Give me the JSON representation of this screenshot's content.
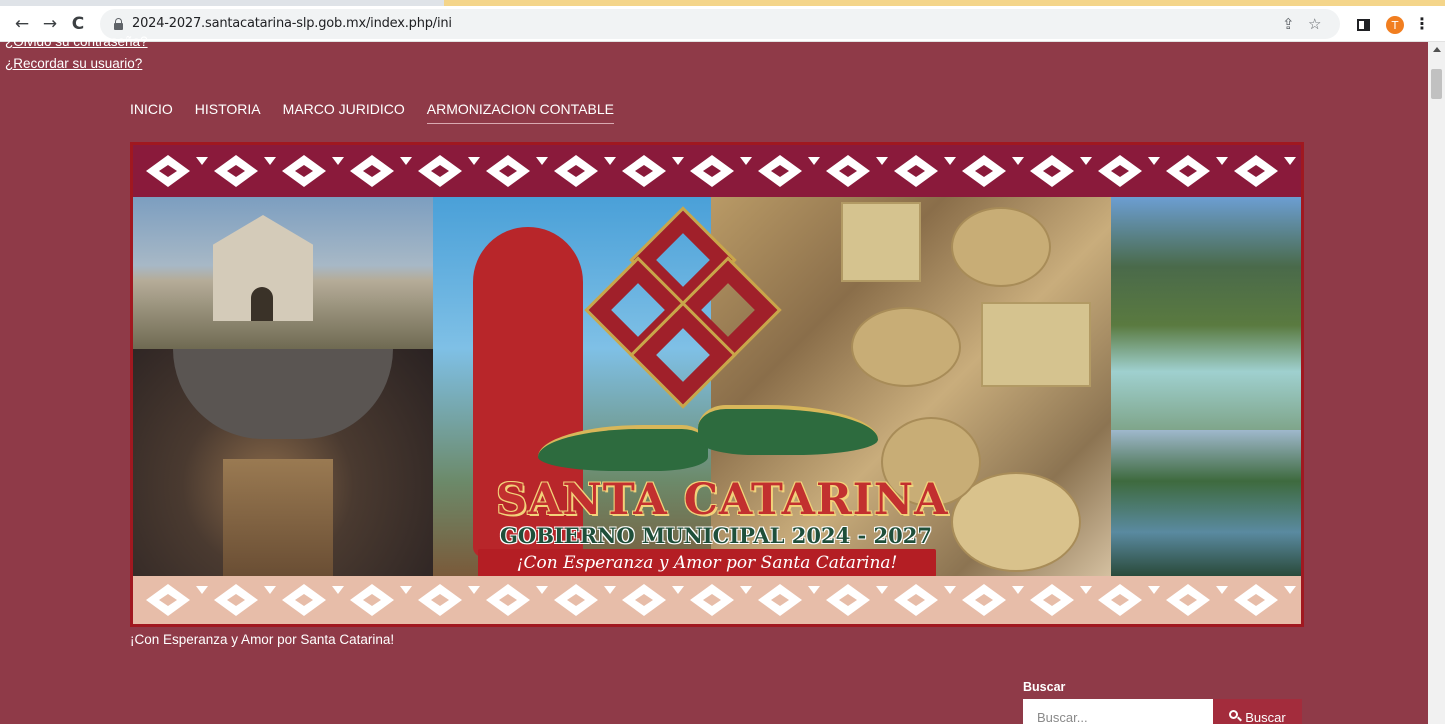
{
  "browser": {
    "url": "2024-2027.santacatarina-slp.gob.mx/index.php/ini",
    "back_icon": "←",
    "forward_icon": "→",
    "reload_icon": "C",
    "share_icon": "⇪",
    "star_icon": "☆",
    "avatar_letter": "T",
    "menu_icon": "⋮",
    "avatar_color": "#f17e20"
  },
  "login": {
    "forgot_password": "¿Olvidó su contraseña?",
    "forgot_username": "¿Recordar su usuario?"
  },
  "nav": {
    "items": [
      {
        "label": "INICIO"
      },
      {
        "label": "HISTORIA"
      },
      {
        "label": "MARCO JURIDICO"
      },
      {
        "label": "ARMONIZACION CONTABLE"
      }
    ],
    "active_index": 3
  },
  "banner": {
    "title": "SANTA CATARINA",
    "subtitle": "GOBIERNO MUNICIPAL 2024 - 2027",
    "slogan": "¡Con Esperanza y Amor por Santa Catarina!",
    "motif": "✦❖✦"
  },
  "tagline": "¡Con Esperanza y Amor por Santa Catarina!",
  "search": {
    "label": "Buscar",
    "placeholder": "Buscar...",
    "button_label": "Buscar"
  },
  "colors": {
    "page_bg": "#8f3a48",
    "banner_border": "#a01820",
    "button_bg": "#a32c3c"
  }
}
